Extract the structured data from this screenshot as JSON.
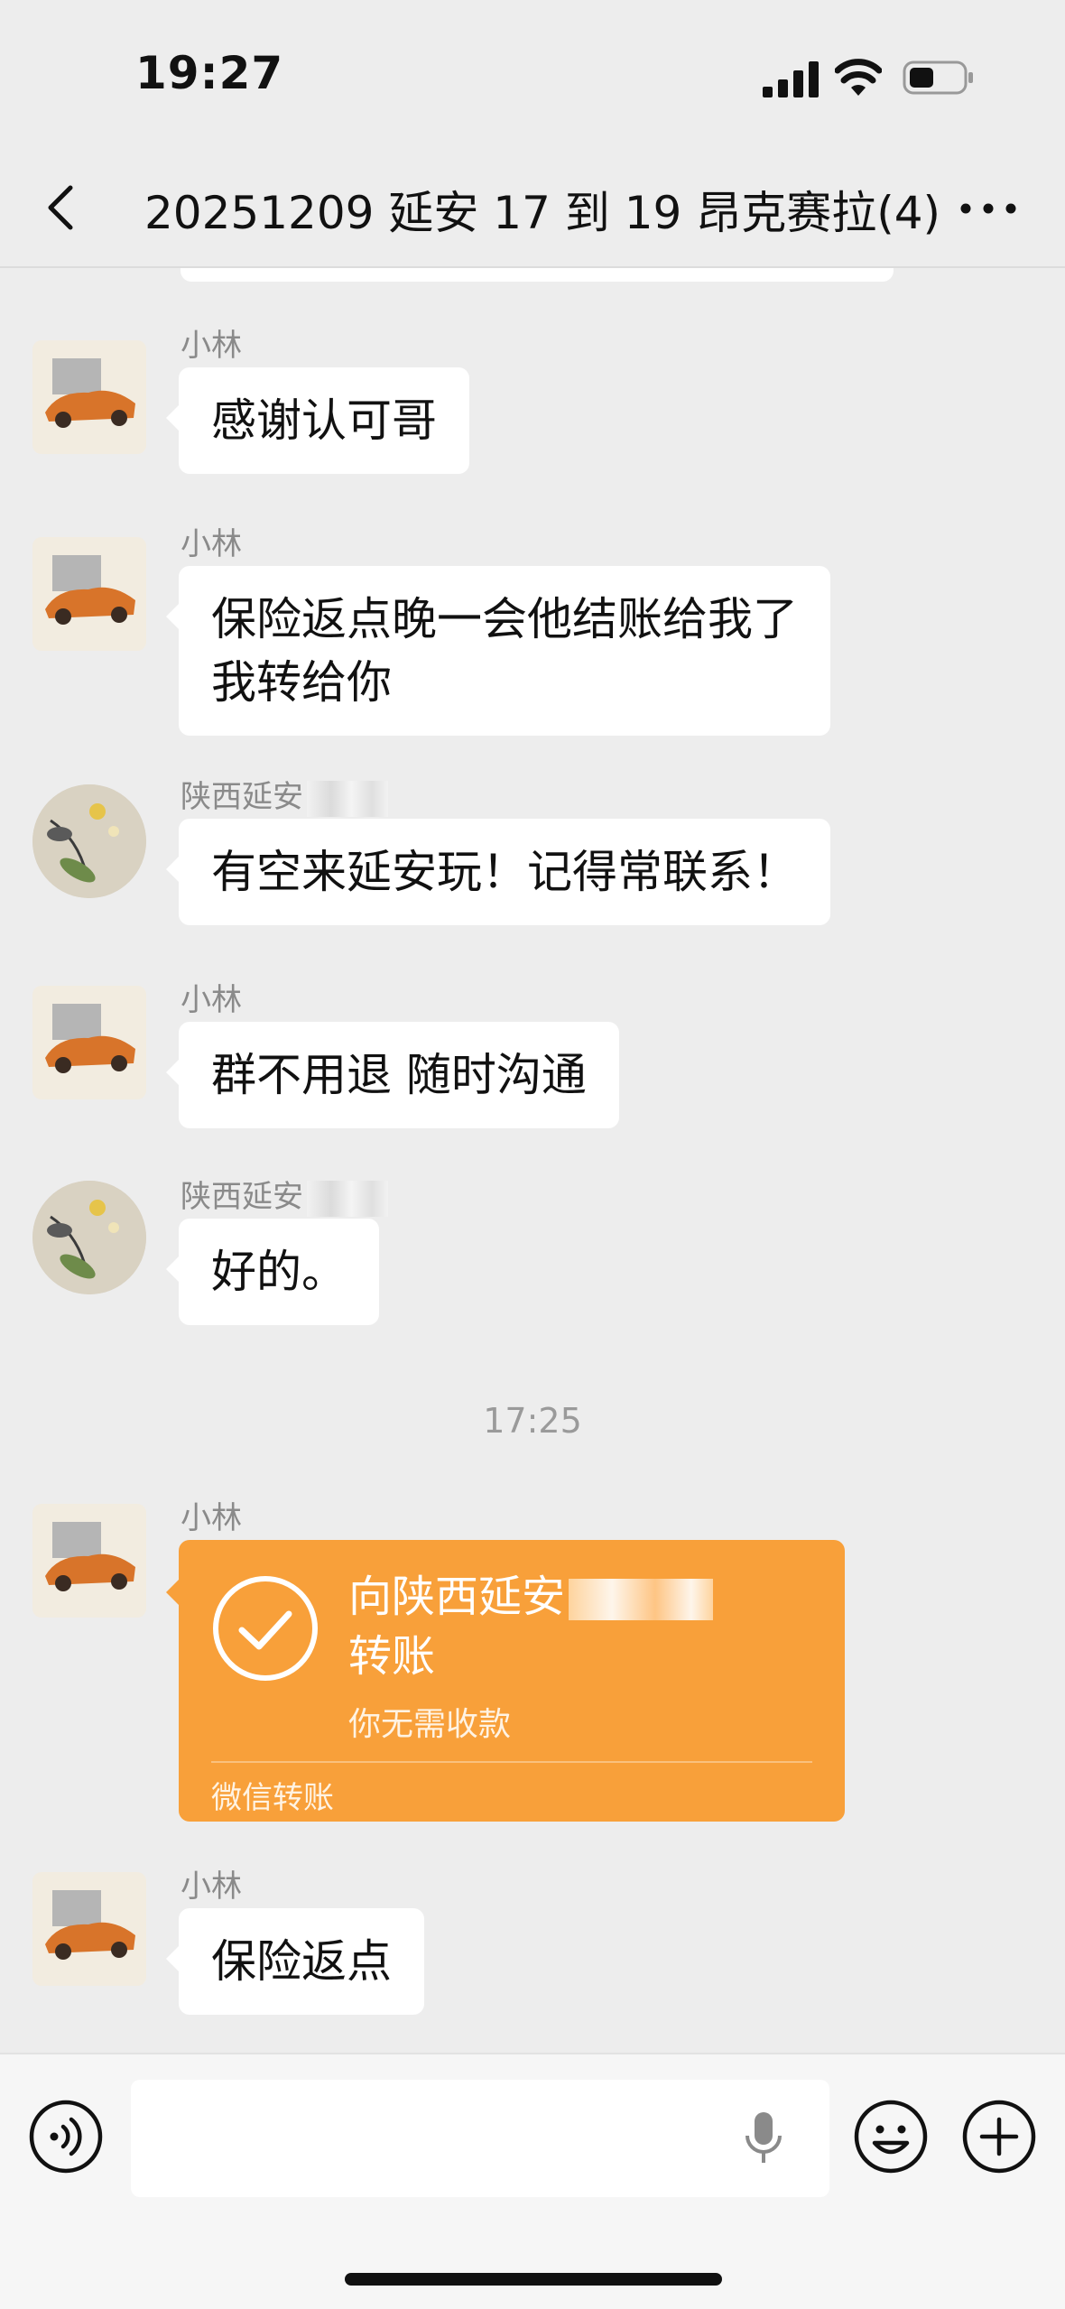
{
  "status_bar": {
    "time": "19:27"
  },
  "header": {
    "title": "20251209 延安 17 到 19 昂克赛拉(4)"
  },
  "messages": [
    {
      "sender": "小林",
      "text": "感谢认可哥"
    },
    {
      "sender": "小林",
      "lines": [
        "保险返点晚一会他结账给我了",
        "我转给你"
      ]
    },
    {
      "sender": "陕西延安",
      "text": "有空来延安玩！记得常联系！"
    },
    {
      "sender": "小林",
      "text": "群不用退 随时沟通"
    },
    {
      "sender": "陕西延安",
      "text": "好的。"
    },
    {
      "sender": "小林",
      "text": "保险返点"
    }
  ],
  "timestamp": "17:25",
  "transfer": {
    "sender": "小林",
    "title_prefix": "向陕西延安",
    "title_suffix": "转账",
    "subtitle": "你无需收款",
    "footer": "微信转账",
    "color": "#f8a03a"
  },
  "input_bar": {
    "placeholder": ""
  },
  "icons": [
    "back-arrow-icon",
    "more-icon",
    "voice-icon",
    "microphone-icon",
    "emoji-icon",
    "plus-icon",
    "signal-icon",
    "wifi-icon",
    "battery-icon"
  ]
}
